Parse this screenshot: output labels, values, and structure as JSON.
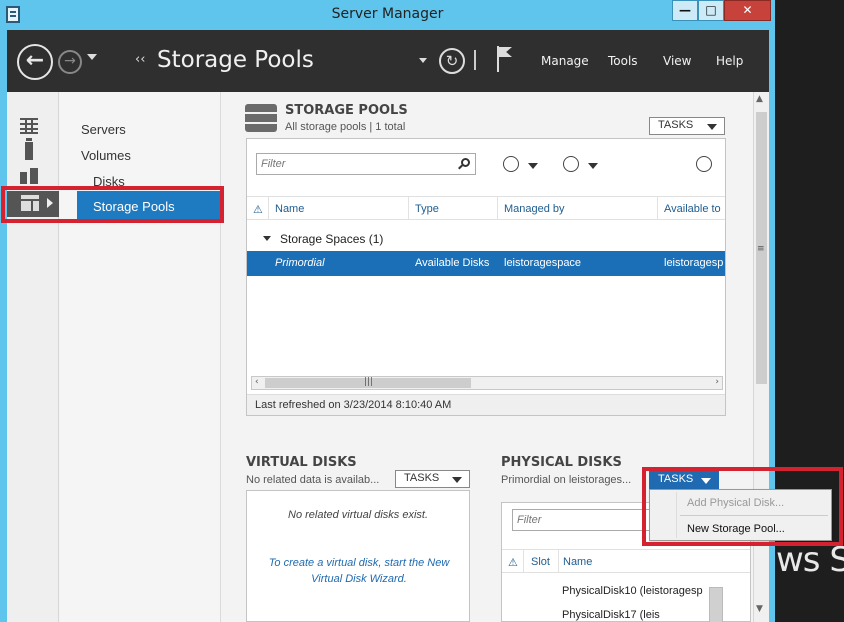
{
  "window": {
    "title": "Server Manager",
    "min": "—",
    "max": "□",
    "close": "✕"
  },
  "header": {
    "breadcrumb_sep": "‹‹",
    "page_title": "Storage Pools",
    "menus": [
      "Manage",
      "Tools",
      "View",
      "Help"
    ]
  },
  "nav": {
    "items": [
      "Servers",
      "Volumes",
      "Disks",
      "Storage Pools"
    ],
    "selected": "Storage Pools"
  },
  "storage_pools": {
    "title": "STORAGE POOLS",
    "subtitle": "All storage pools | 1 total",
    "tasks_label": "TASKS",
    "filter_placeholder": "Filter",
    "columns": [
      "Name",
      "Type",
      "Managed by",
      "Available to"
    ],
    "group": "Storage Spaces (1)",
    "rows": [
      {
        "name": "Primordial",
        "type": "Available Disks",
        "managed_by": "leistoragespace",
        "available_to": "leistoragesp"
      }
    ],
    "last_refreshed": "Last refreshed on 3/23/2014 8:10:40 AM"
  },
  "virtual_disks": {
    "title": "VIRTUAL DISKS",
    "subtitle": "No related data is availab...",
    "tasks_label": "TASKS",
    "empty_message": "No related virtual disks exist.",
    "link_text": "To create a virtual disk, start the New Virtual Disk Wizard."
  },
  "physical_disks": {
    "title": "PHYSICAL DISKS",
    "subtitle": "Primordial on leistorages...",
    "tasks_label": "TASKS",
    "filter_placeholder": "Filter",
    "columns": [
      "Slot",
      "Name"
    ],
    "rows": [
      "PhysicalDisk10 (leistoragesp",
      "PhysicalDisk17 (leis"
    ]
  },
  "tasks_menu": {
    "items": [
      {
        "label": "Add Physical Disk...",
        "enabled": false
      },
      {
        "label": "New Storage Pool...",
        "enabled": true
      }
    ]
  },
  "background_text": "ws Se",
  "colors": {
    "accent": "#1f7bc1",
    "highlight": "#d52230",
    "header": "#2f2f2f",
    "window_frame": "#5fc5ec"
  }
}
